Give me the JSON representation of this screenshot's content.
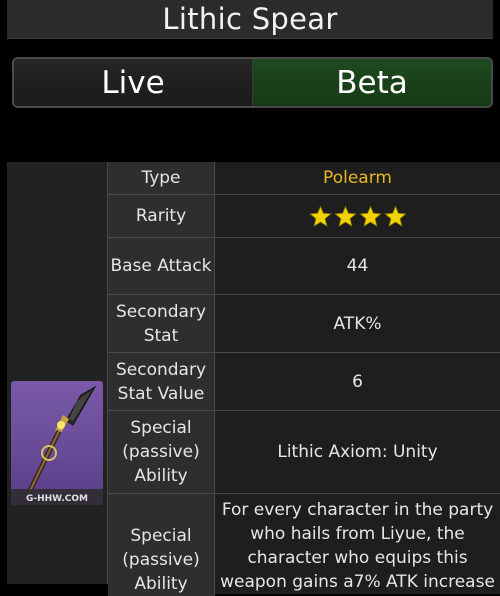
{
  "title": "Lithic Spear",
  "toggle": {
    "live": "Live",
    "beta": "Beta",
    "active": "beta"
  },
  "image": {
    "watermark": "G-HHW.COM"
  },
  "stats": [
    {
      "label": "Type",
      "value": "Polearm",
      "highlight": "#e8b820"
    },
    {
      "label": "Rarity",
      "stars": 4
    },
    {
      "label": "Base Attack",
      "value": "44"
    },
    {
      "label": "Secondary Stat",
      "value": "ATK%"
    },
    {
      "label": "Secondary Stat Value",
      "value": "6"
    },
    {
      "label": "Special (passive) Ability",
      "value": "Lithic Axiom: Unity"
    },
    {
      "label": "Special (passive) Ability",
      "value": "For every character in the party who hails from Liyue, the character who equips this weapon gains a7% ATK increase"
    }
  ],
  "colors": {
    "star": "#f2d200",
    "beta_active": "#1f4a1f"
  }
}
